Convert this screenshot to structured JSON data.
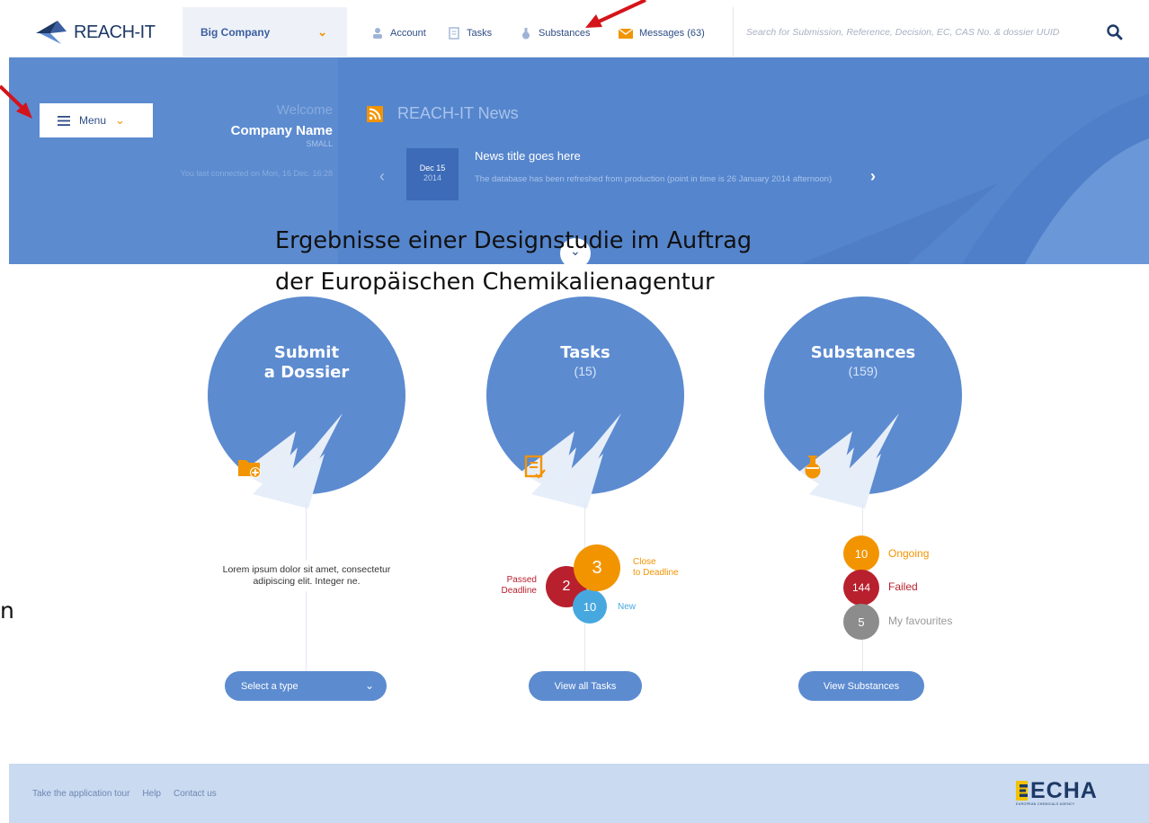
{
  "header": {
    "logo_text": "REACH-IT",
    "company": "Big Company",
    "nav": {
      "account": "Account",
      "tasks": "Tasks",
      "substances": "Substances",
      "messages": "Messages (63)"
    },
    "search_placeholder": "Search for Submission, Reference, Decision, EC, CAS No. & dossier UUID"
  },
  "hero": {
    "menu_label": "Menu",
    "welcome": "Welcome",
    "company_name": "Company Name",
    "company_size": "SMALL",
    "last_connected": "You last connected on Mon, 16 Dec. 16:28",
    "news_heading": "REACH-IT News",
    "news_date_day": "Dec 15",
    "news_date_year": "2014",
    "news_title": "News title goes here",
    "news_body": "The database has been refreshed from production (point in time is 26 January 2014 afternoon)"
  },
  "overlay": {
    "line1": "Ergebnisse einer Designstudie im Auftrag",
    "line2": "der Europäischen Chemikalienagentur",
    "stray_char": "n"
  },
  "cards": {
    "submit": {
      "title_line1": "Submit",
      "title_line2": "a Dossier",
      "description": "Lorem ipsum dolor sit amet, consectetur adipiscing elit. Integer ne.",
      "button": "Select a type"
    },
    "tasks": {
      "title": "Tasks",
      "count": "(15)",
      "close_count": "3",
      "close_label_1": "Close",
      "close_label_2": "to Deadline",
      "passed_count": "2",
      "passed_label_1": "Passed",
      "passed_label_2": "Deadline",
      "new_count": "10",
      "new_label": "New",
      "button": "View  all Tasks"
    },
    "substances": {
      "title": "Substances",
      "count": "(159)",
      "ongoing_count": "10",
      "ongoing_label": "Ongoing",
      "failed_count": "144",
      "failed_label": "Failed",
      "fav_count": "5",
      "fav_label": "My favourites",
      "button": "View Substances"
    }
  },
  "footer": {
    "tour": "Take the application tour",
    "help": "Help",
    "contact": "Contact us",
    "echa_logo": "ECHA",
    "echa_subtitle": "EUROPEAN CHEMICALS AGENCY"
  },
  "colors": {
    "brand_blue": "#5c8bd0",
    "accent_orange": "#f29400",
    "alert_red": "#b8202e",
    "info_blue": "#47a8e0",
    "neutral_gray": "#8c8c8c",
    "annotation_red": "#d4141a"
  }
}
